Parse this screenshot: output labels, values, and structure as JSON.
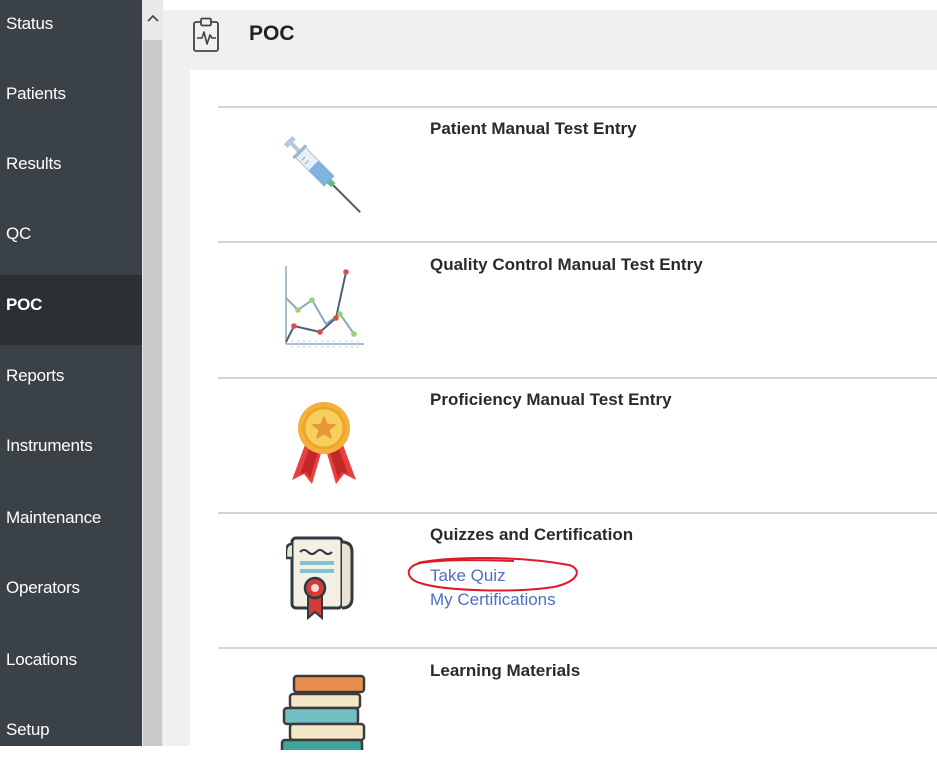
{
  "sidebar": {
    "items": [
      {
        "label": "Status"
      },
      {
        "label": "Patients"
      },
      {
        "label": "Results"
      },
      {
        "label": "QC"
      },
      {
        "label": "POC"
      },
      {
        "label": "Reports"
      },
      {
        "label": "Instruments"
      },
      {
        "label": "Maintenance"
      },
      {
        "label": "Operators"
      },
      {
        "label": "Locations"
      },
      {
        "label": "Setup"
      }
    ],
    "active": "POC"
  },
  "header": {
    "title": "POC",
    "icon": "clipboard-pulse-icon"
  },
  "sections": [
    {
      "title": "Patient Manual Test Entry",
      "icon": "syringe-icon"
    },
    {
      "title": "Quality Control Manual Test Entry",
      "icon": "qc-chart-icon"
    },
    {
      "title": "Proficiency Manual Test Entry",
      "icon": "award-medal-icon"
    },
    {
      "title": "Quizzes and Certification",
      "icon": "certificate-scroll-icon",
      "links": [
        "Take Quiz",
        "My Certifications"
      ]
    },
    {
      "title": "Learning Materials",
      "icon": "books-icon"
    }
  ],
  "colors": {
    "sidebar_bg": "#3b4247",
    "sidebar_active_bg": "#2b3034",
    "link": "#4e6fc0",
    "annotation": "#e0192a"
  }
}
